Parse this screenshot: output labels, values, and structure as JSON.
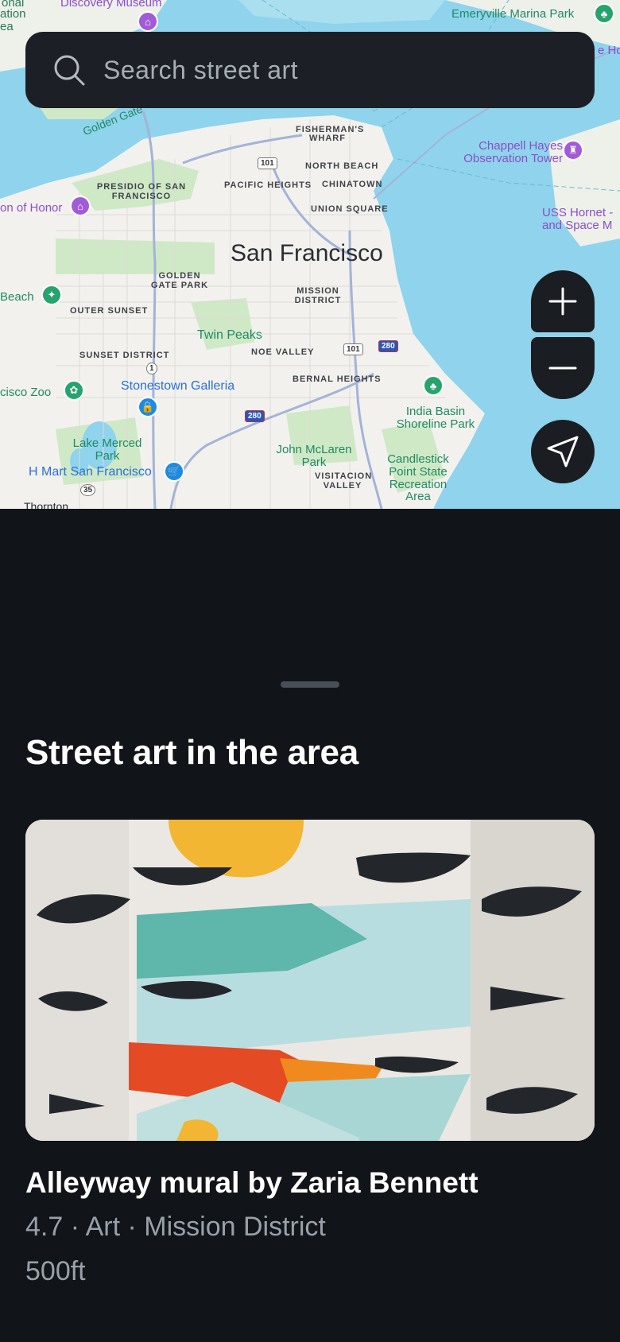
{
  "map": {
    "city": "San Francisco",
    "labels": {
      "discovery": "Discovery Museum",
      "partial_top": "onal",
      "partial_top2": "ation",
      "partial_top3": "ea",
      "emeryville": "Emeryville Marina Park",
      "partial_right": "e Ho",
      "golden_gate": "Golden Gate",
      "fishermans": "FISHERMAN'S WHARF",
      "north_beach": "NORTH BEACH",
      "chappell": "Chappell Hayes Observation Tower",
      "presidio": "PRESIDIO OF SAN FRANCISCO",
      "pacific_heights": "PACIFIC HEIGHTS",
      "chinatown": "CHINATOWN",
      "legion": "on of Honor",
      "union_square": "UNION SQUARE",
      "uss_hornet": "USS Hornet - and Space M",
      "golden_gate_park": "GOLDEN GATE PARK",
      "mission": "MISSION DISTRICT",
      "beach": "Beach",
      "outer_sunset": "OUTER SUNSET",
      "twin_peaks": "Twin Peaks",
      "noe_valley": "NOE VALLEY",
      "sunset": "SUNSET DISTRICT",
      "bernal": "BERNAL HEIGHTS",
      "zoo": "cisco Zoo",
      "stonestown": "Stonestown Galleria",
      "india_basin": "India Basin Shoreline Park",
      "lake_merced": "Lake Merced Park",
      "john_mclaren": "John McLaren Park",
      "candlestick": "Candlestick Point State Recreation Area",
      "hmart": "H Mart San Francisco",
      "visitacion": "VISITACION VALLEY",
      "thornton": "Thornton"
    },
    "shields": {
      "us101a": "101",
      "us101b": "101",
      "i280a": "280",
      "i280b": "280",
      "ca1": "1",
      "ca35": "35"
    }
  },
  "search": {
    "placeholder": "Search street art",
    "icon": "search-icon"
  },
  "controls": {
    "zoom_in_icon": "plus-icon",
    "zoom_out_icon": "minus-icon",
    "locate_icon": "navigation-arrow-icon"
  },
  "sheet": {
    "title": "Street art in the area",
    "cards": [
      {
        "title": "Alleyway mural by Zaria Bennett",
        "meta": "4.7 · Art · Mission District",
        "distance": "500ft"
      }
    ]
  },
  "colors": {
    "background": "#111418",
    "search_bg": "#1c2026",
    "control_bg": "#1a1d22",
    "water": "#8fd3ec",
    "land": "#f2f1ee"
  }
}
